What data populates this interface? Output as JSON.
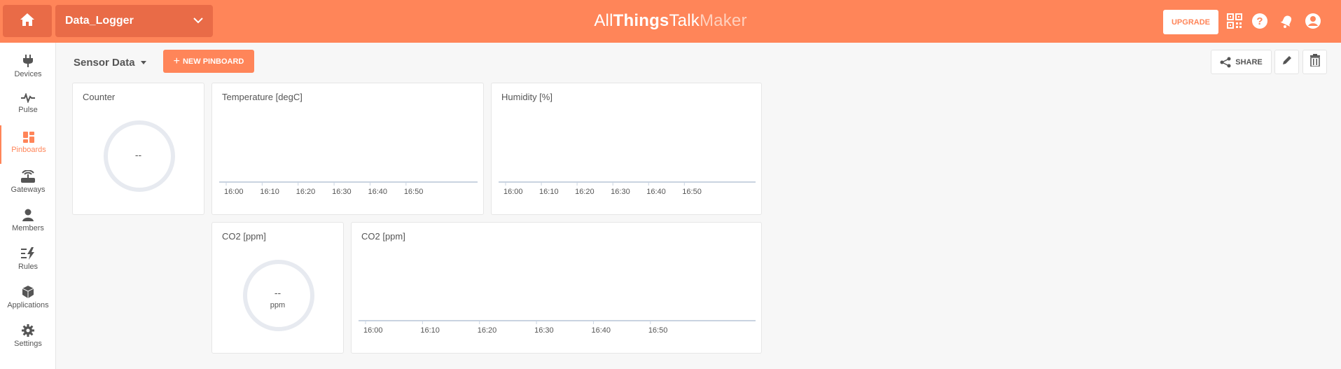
{
  "header": {
    "device_name": "Data_Logger",
    "brand_all": "All",
    "brand_things": "Things",
    "brand_talk": "Talk",
    "brand_maker": "Maker",
    "upgrade_label": "UPGRADE",
    "accent_color": "#ff8559",
    "icons": [
      "home-icon",
      "chevron-down-icon",
      "qr-code-icon",
      "help-icon",
      "notification-bell-icon",
      "account-icon"
    ]
  },
  "sidebar": {
    "items": [
      {
        "label": "Devices",
        "icon": "plug-icon"
      },
      {
        "label": "Pulse",
        "icon": "pulse-icon"
      },
      {
        "label": "Pinboards",
        "icon": "pinboards-icon",
        "active": true
      },
      {
        "label": "Gateways",
        "icon": "gateway-icon"
      },
      {
        "label": "Members",
        "icon": "person-icon"
      },
      {
        "label": "Rules",
        "icon": "rules-icon"
      },
      {
        "label": "Applications",
        "icon": "cube-icon"
      },
      {
        "label": "Settings",
        "icon": "gear-icon"
      }
    ]
  },
  "toolbar": {
    "pinboard_name": "Sensor Data",
    "new_pinboard_label": "NEW PINBOARD",
    "share_label": "SHARE"
  },
  "widgets": {
    "counter": {
      "title": "Counter",
      "value": "--"
    },
    "temperature": {
      "title": "Temperature [degC]"
    },
    "humidity": {
      "title": "Humidity [%]"
    },
    "co2_gauge": {
      "title": "CO2 [ppm]",
      "value": "--",
      "unit": "ppm"
    },
    "co2_chart": {
      "title": "CO2 [ppm]"
    }
  },
  "chart_data": [
    {
      "type": "line",
      "title": "Temperature [degC]",
      "x": [
        "16:00",
        "16:10",
        "16:20",
        "16:30",
        "16:40",
        "16:50"
      ],
      "series": []
    },
    {
      "type": "line",
      "title": "Humidity [%]",
      "x": [
        "16:00",
        "16:10",
        "16:20",
        "16:30",
        "16:40",
        "16:50"
      ],
      "series": []
    },
    {
      "type": "line",
      "title": "CO2 [ppm]",
      "x": [
        "16:00",
        "16:10",
        "16:20",
        "16:30",
        "16:40",
        "16:50"
      ],
      "series": []
    }
  ]
}
